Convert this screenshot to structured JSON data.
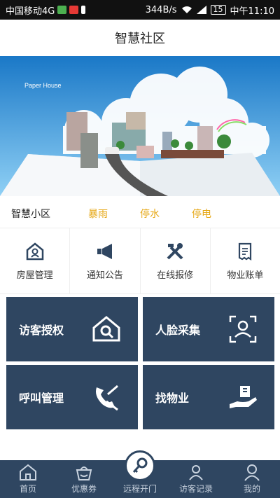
{
  "statusbar": {
    "carrier": "中国移动4G",
    "speed": "344B/s",
    "battery": "15",
    "time": "中午11:10"
  },
  "header": {
    "title": "智慧社区"
  },
  "banner": {
    "caption": "Paper House"
  },
  "notice": {
    "label": "智慧小区",
    "tags": [
      "暴雨",
      "停水",
      "停电"
    ]
  },
  "services": [
    {
      "label": "房屋管理",
      "icon": "house-icon"
    },
    {
      "label": "通知公告",
      "icon": "megaphone-icon"
    },
    {
      "label": "在线报修",
      "icon": "tools-icon"
    },
    {
      "label": "物业账单",
      "icon": "bill-icon"
    }
  ],
  "tiles": [
    {
      "label": "访客授权",
      "icon": "house-search-icon"
    },
    {
      "label": "人脸采集",
      "icon": "face-scan-icon"
    },
    {
      "label": "呼叫管理",
      "icon": "phone-wrench-icon"
    },
    {
      "label": "找物业",
      "icon": "hand-building-icon"
    }
  ],
  "nav": [
    {
      "label": "首页",
      "icon": "home-icon"
    },
    {
      "label": "优惠券",
      "icon": "basket-icon"
    },
    {
      "label": "远程开门",
      "icon": "key-icon"
    },
    {
      "label": "访客记录",
      "icon": "visitors-icon"
    },
    {
      "label": "我的",
      "icon": "user-icon"
    }
  ],
  "colors": {
    "tile": "#2f4661",
    "accent": "#e6a817"
  }
}
